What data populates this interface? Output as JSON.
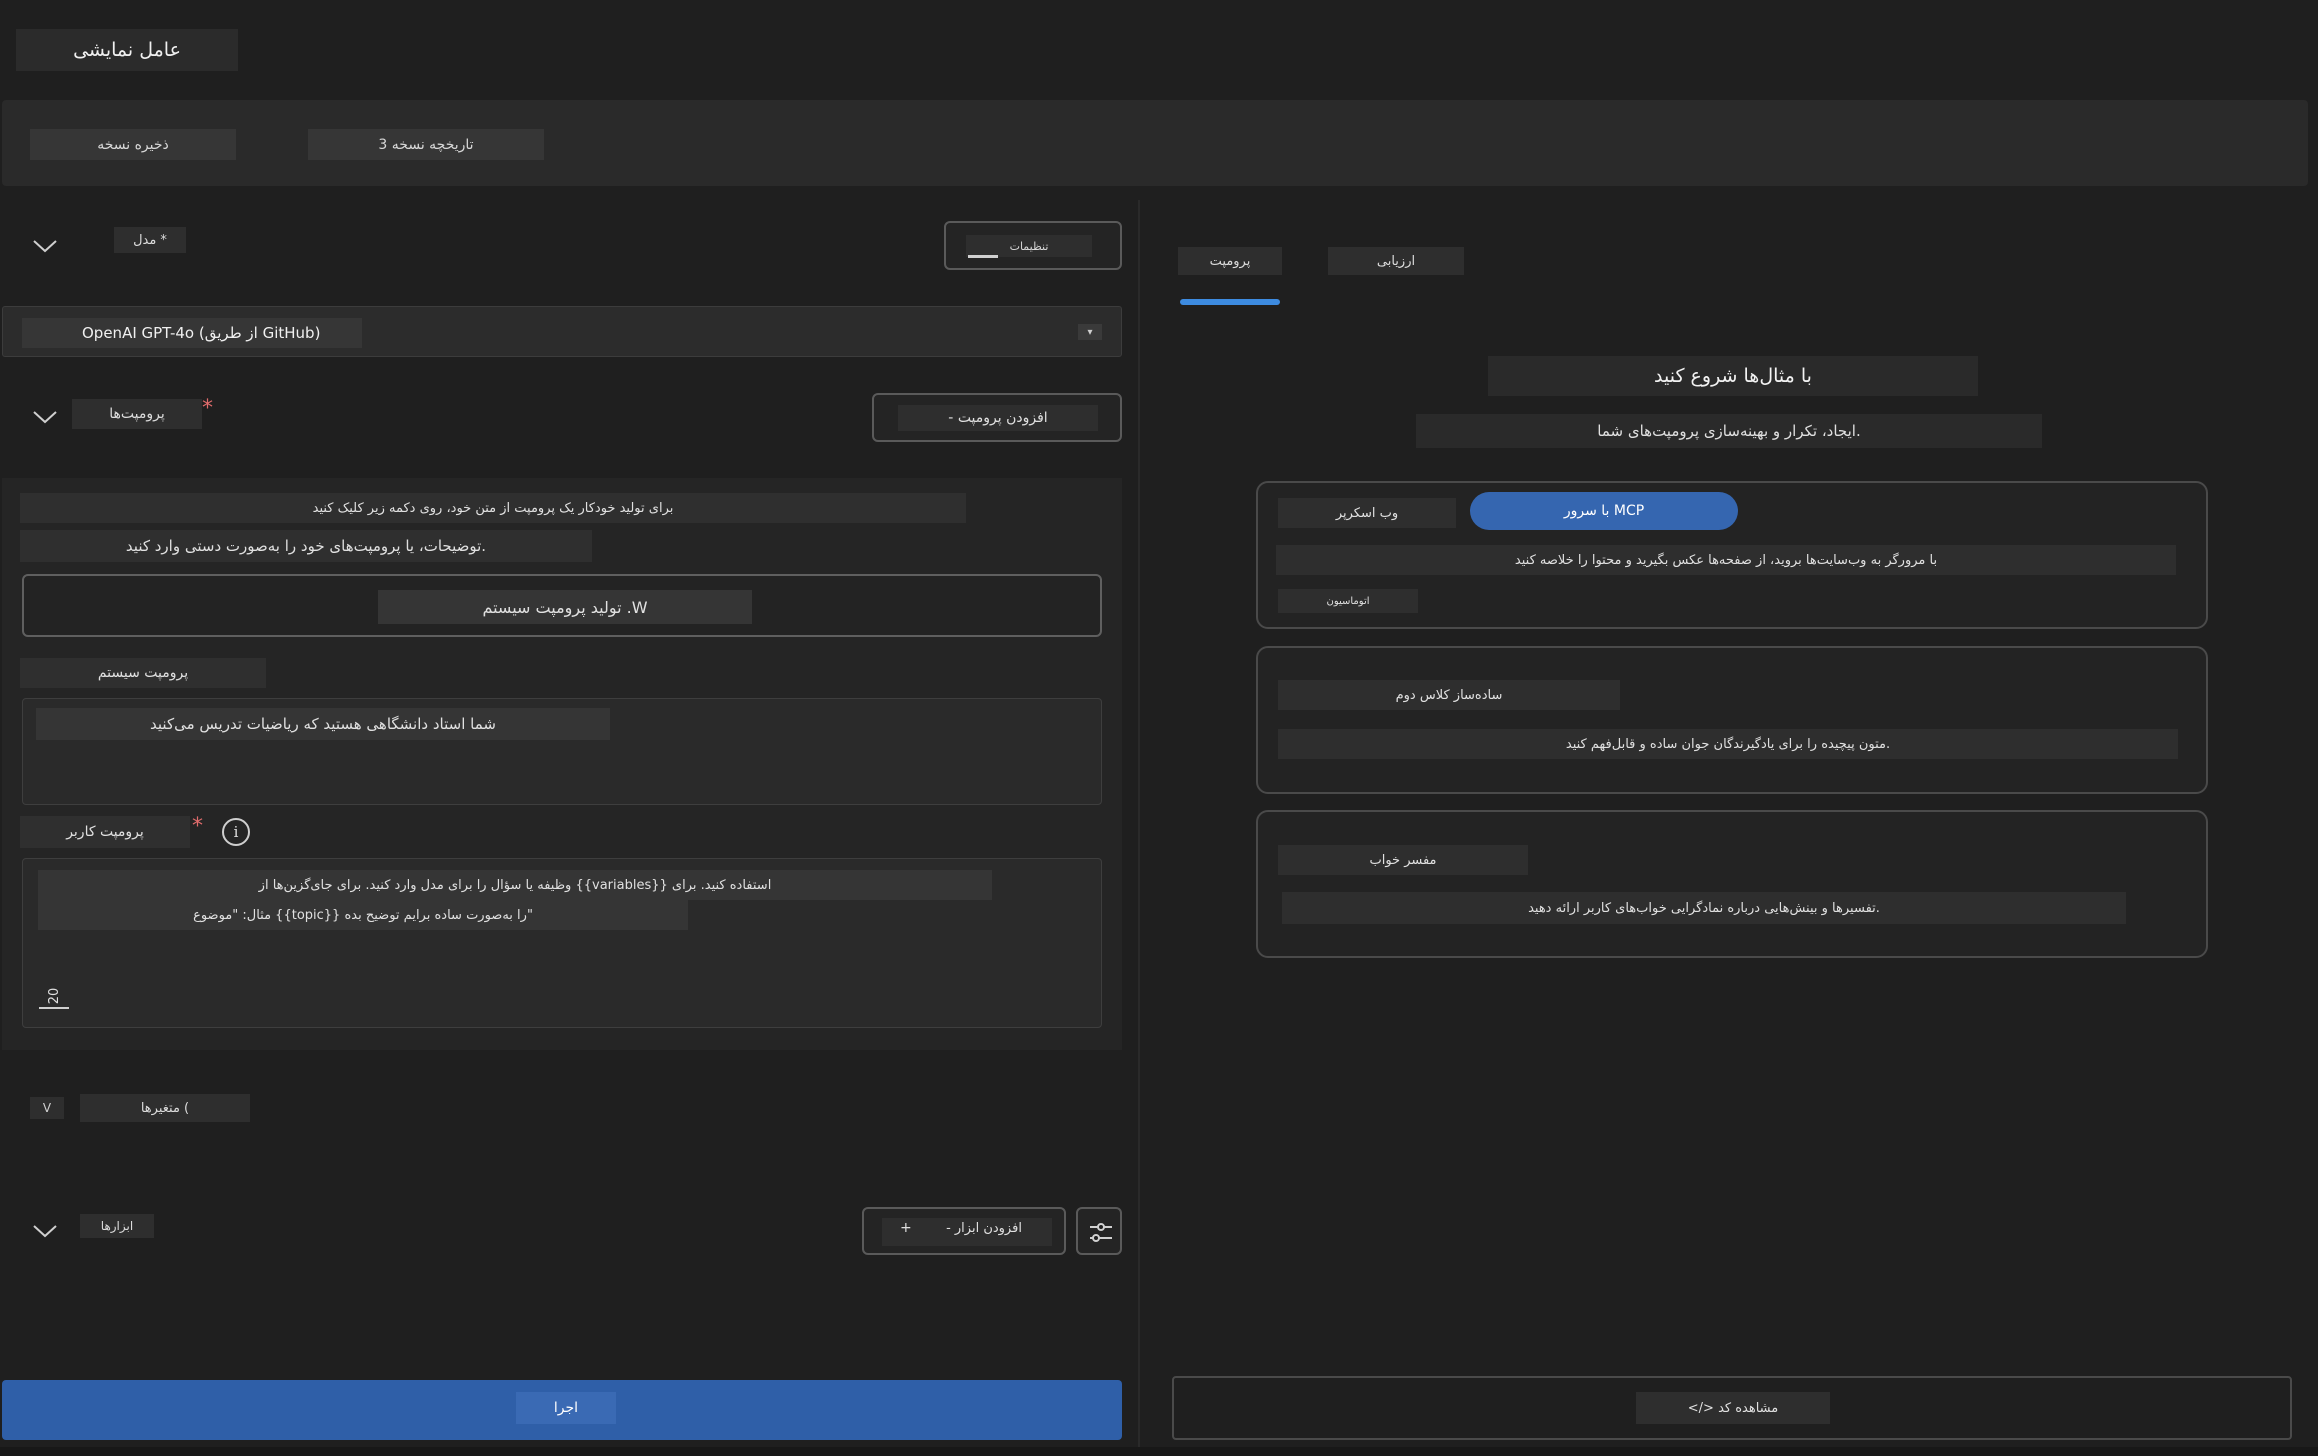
{
  "app": {
    "title": "عامل نمایشی"
  },
  "toolbar": {
    "save_version": "ذخیره نسخه",
    "version_history": "3 تاریخچه نسخه"
  },
  "model": {
    "label": "مدل *",
    "settings_label": "تنظیمات",
    "selected": "OpenAI GPT-4o (از طریق GitHub)",
    "dropdown_glyph": "▾"
  },
  "prompts": {
    "label": "پرومپت‌ها",
    "required_mark": "*",
    "add_prompt": "- افزودن پرومپت",
    "auto_hint": "برای تولید خودکار یک پرومپت از متن خود، روی دکمه زیر کلیک کنید",
    "manual_hint": "توضیحات، یا پرومپت‌های خود را به‌صورت دستی وارد کنید.",
    "generate_button": "تولید پرومپت سیستم .W",
    "system_label": "پرومپت سیستم",
    "system_value": "شما استاد دانشگاهی هستید که ریاضیات تدریس می‌کنید",
    "user_label": "پرومپت کاربر",
    "user_placeholder_line1": "وظیفه یا سؤال را برای مدل وارد کنید. برای جای‌گزین‌ها از {{variables}} استفاده کنید. برای",
    "user_placeholder_line2": "مثال: \"موضوع {{topic}} را به‌صورت ساده برایم توضیح بده\"",
    "counter": "20"
  },
  "variables": {
    "label": "متغیرها (",
    "toggle": "V"
  },
  "tools": {
    "label": "ابزارها",
    "add_tool": "- افزودن ابزار",
    "plus": "+"
  },
  "run_button": "اجرا",
  "tabs": [
    {
      "label": "پرومپت",
      "active": true
    },
    {
      "label": "ارزیابی",
      "active": false
    }
  ],
  "examples": {
    "heading": "با مثال‌ها شروع کنید",
    "subheading": "ایجاد، تکرار و بهینه‌سازی پرومپت‌های شما.",
    "cards": [
      {
        "title": "وب اسکرپر",
        "badge": "با سرور MCP",
        "description": "با مرورگر به وب‌سایت‌ها بروید، از صفحه‌ها عکس بگیرید و محتوا را خلاصه کنید",
        "tag": "اتوماسیون"
      },
      {
        "title": "ساده‌ساز کلاس دوم",
        "description": "متون پیچیده را برای یادگیرندگان جوان ساده و قابل‌فهم کنید."
      },
      {
        "title": "مفسر خواب",
        "description": "تفسیرها و بینش‌هایی درباره نمادگرایی خواب‌های کاربر ارائه دهید."
      }
    ]
  },
  "view_code": "</> مشاهده کد",
  "colors": {
    "accent": "#3d8be0",
    "run_button": "#2f5fa8",
    "mcp_pill": "#3566b0",
    "required": "#e06c6c"
  }
}
